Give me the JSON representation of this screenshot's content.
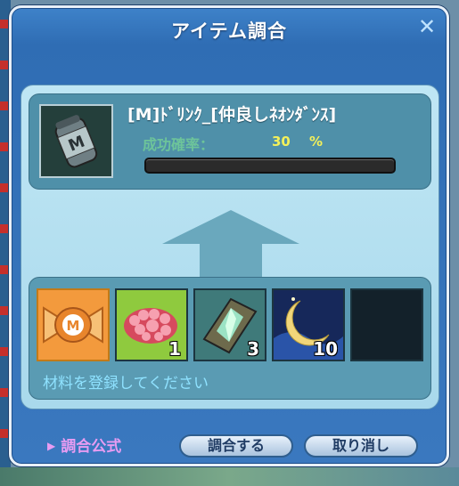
{
  "window": {
    "title": "アイテム調合",
    "close_symbol": "✕"
  },
  "result": {
    "icon": "drink-bottle-icon",
    "name": "[M]ﾄﾞﾘﾝｸ_[仲良しﾈｵﾝﾀﾞﾝｽ]",
    "success_rate_label": "成功確率：",
    "success_rate_value": "30",
    "success_rate_unit": "%",
    "progress_fill": 0.0
  },
  "materials": {
    "slots": [
      {
        "icon": "m-candy-icon",
        "count": ""
      },
      {
        "icon": "pink-flower-bush-icon",
        "count": "1"
      },
      {
        "icon": "crystal-card-icon",
        "count": "3"
      },
      {
        "icon": "crescent-moon-icon",
        "count": "10"
      },
      {
        "icon": "empty-slot",
        "count": ""
      }
    ],
    "hint": "材料を登録してください"
  },
  "footer": {
    "formula_link": "調合公式",
    "mix_button": "調合する",
    "cancel_button": "取り消し"
  },
  "colors": {
    "window_blue": "#3a78bf",
    "inner_light": "#bfe6f4",
    "panel_teal": "#4f90a9",
    "rate_label": "#6dc49a",
    "rate_value": "#f3f05a",
    "hint_text": "#8fe2ff",
    "formula_link": "#e79cf2"
  }
}
